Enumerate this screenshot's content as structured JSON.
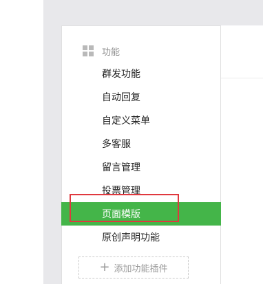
{
  "sidebar": {
    "section_title": "功能",
    "section_icon": "grid-icon",
    "items": [
      {
        "label": "群发功能"
      },
      {
        "label": "自动回复"
      },
      {
        "label": "自定义菜单"
      },
      {
        "label": "多客服"
      },
      {
        "label": "留言管理"
      },
      {
        "label": "投票管理"
      },
      {
        "label": "页面模版",
        "active": true
      },
      {
        "label": "原创声明功能"
      }
    ],
    "add_plugin_label": "添加功能插件",
    "add_plugin_icon": "plus-icon"
  },
  "colors": {
    "active_bg": "#44b549",
    "highlight_border": "#e0383e"
  }
}
